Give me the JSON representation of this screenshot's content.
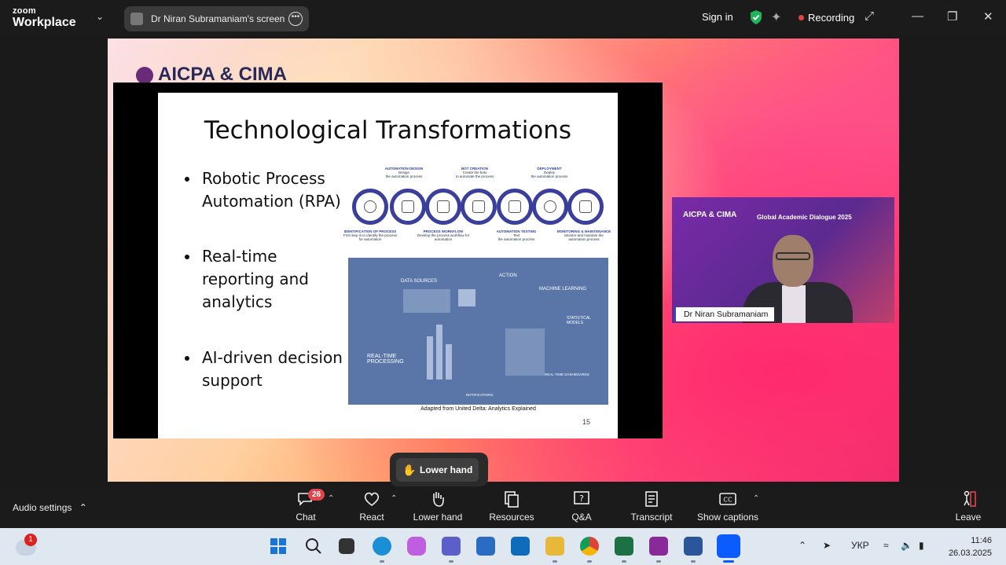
{
  "app": {
    "brand_top": "zoom",
    "brand_bottom": "Workplace"
  },
  "share": {
    "title": "Dr Niran Subramaniam's screen"
  },
  "header": {
    "sign_in": "Sign in",
    "recording": "Recording"
  },
  "slide": {
    "title": "Technological Transformations",
    "bullets": [
      "Robotic Process Automation (RPA)",
      "Real-time reporting and analytics",
      "AI-driven decision support"
    ],
    "rpa_top_labels": [
      {
        "head": "AUTOMATION DESIGN",
        "sub": "Design",
        "desc": "the automation process"
      },
      {
        "head": "BOT CREATION",
        "sub": "Create the bots",
        "desc": "to automate the process"
      },
      {
        "head": "DEPLOYMENT",
        "sub": "Deploy",
        "desc": "the automation process"
      }
    ],
    "rpa_bottom_labels": [
      {
        "head": "IDENTIFICATION OF PROCESS",
        "desc": "First step is to identify the process for automation"
      },
      {
        "head": "PROCESS WORKFLOW",
        "desc": "Develop the process workflow for automation"
      },
      {
        "head": "AUTOMATION TESTING",
        "sub": "Test",
        "desc": "the automation process"
      },
      {
        "head": "MONITORING & MAINTENANCE",
        "desc": "Monitor and maintain the automation process"
      }
    ],
    "analytics_labels": {
      "data_sources": "DATA SOURCES",
      "action": "ACTION",
      "machine_learning": "MACHINE LEARNING",
      "statistical_models": "STATISTICAL MODELS",
      "realtime_processing": "REAL-TIME PROCESSING",
      "realtime_dashboards": "REAL-TIME DASHBOARDS",
      "notifications": "NOTIFICATIONS"
    },
    "caption": "Adapted from United Delta: Analytics Explained",
    "page_number": "15"
  },
  "stage": {
    "logo_text": "AICPA & CIMA"
  },
  "speaker": {
    "logo": "AICPA & CIMA",
    "event": "Global Academic Dialogue 2025",
    "name": "Dr Niran Subramaniam"
  },
  "floating": {
    "lower_hand": "Lower hand"
  },
  "toolbar": {
    "audio_settings": "Audio settings",
    "chat_badge": "26",
    "items": [
      "Chat",
      "React",
      "Lower hand",
      "Resources",
      "Q&A",
      "Transcript",
      "Show captions"
    ],
    "leave": "Leave"
  },
  "taskbar": {
    "weather_badge": "1",
    "language": "УКР",
    "time": "11:46",
    "date": "26.03.2025"
  },
  "colors": {
    "accent_red": "#e0454b",
    "recording": "#e2453c",
    "rpa_ring": "#3b3f9c",
    "analytics_bg": "#5a76a8",
    "shield": "#1fb35a"
  }
}
